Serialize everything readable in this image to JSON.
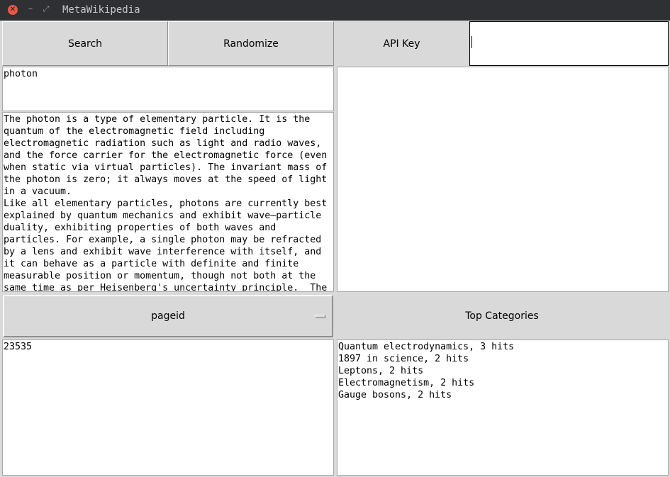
{
  "window": {
    "title": "MetaWikipedia"
  },
  "toolbar": {
    "search_label": "Search",
    "randomize_label": "Randomize",
    "api_key_label": "API Key",
    "api_key_value": ""
  },
  "query": {
    "value": "photon"
  },
  "summary": {
    "lines": [
      "The photon is a type of elementary particle. It is the",
      "quantum of the electromagnetic field including",
      "electromagnetic radiation such as light and radio waves,",
      "and the force carrier for the electromagnetic force (even",
      "when static via virtual particles). The invariant mass of",
      "the photon is zero; it always moves at the speed of light",
      "in a vacuum.",
      "Like all elementary particles, photons are currently best",
      "explained by quantum mechanics and exhibit wave–particle",
      "duality, exhibiting properties of both waves and",
      "particles. For example, a single photon may be refracted",
      "by a lens and exhibit wave interference with itself, and",
      "it can behave as a particle with definite and finite",
      "measurable position or momentum, though not both at the",
      "same time as per Heisenberg's uncertainty principle.  The"
    ]
  },
  "property_menu": {
    "selected": "pageid"
  },
  "property_value": {
    "value": "23535"
  },
  "top_categories": {
    "label": "Top Categories",
    "items": [
      "Quantum electrodynamics, 3 hits",
      "1897 in science, 2 hits",
      "Leptons, 2 hits",
      "Electromagnetism, 2 hits",
      "Gauge bosons, 2 hits"
    ]
  }
}
